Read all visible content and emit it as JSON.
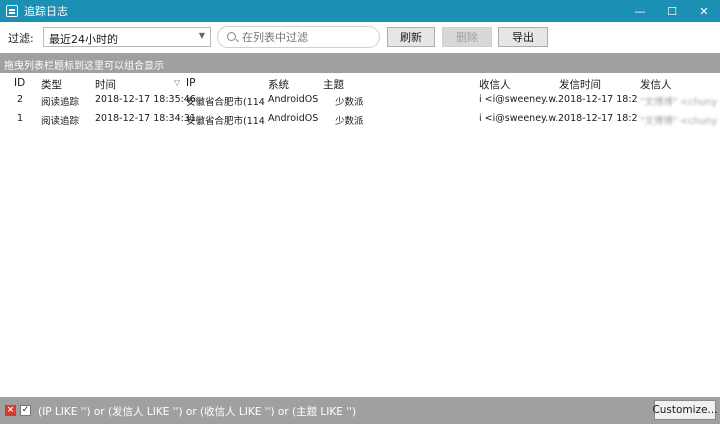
{
  "window": {
    "title": "追踪日志",
    "minimize": "—",
    "maximize": "☐",
    "close": "✕"
  },
  "toolbar": {
    "filter_label": "过滤:",
    "filter_value": "最近24小时的",
    "search_placeholder": "在列表中过滤",
    "refresh_label": "刷新",
    "delete_label": "删除",
    "export_label": "导出"
  },
  "group_panel": {
    "hint": "拖曳列表栏题标到这里可以组合显示"
  },
  "columns": {
    "id": "ID",
    "type": "类型",
    "time": "时间",
    "ip": "IP",
    "system": "系统",
    "subject": "主题",
    "recipient": "收信人",
    "sent_time": "发信时间",
    "sender": "发信人"
  },
  "rows": [
    {
      "id": "2",
      "type": "阅读追踪",
      "time": "2018-12-17 18:35:46",
      "ip": "安徽省合肥市(114....",
      "system": "AndroidOS",
      "subject": "少数派",
      "recipient": "i <i@sweeney.w...",
      "sent_time": "2018-12-17 18:27...",
      "sender": "\"文博博\" <chunyu..."
    },
    {
      "id": "1",
      "type": "阅读追踪",
      "time": "2018-12-17 18:34:31",
      "ip": "安徽省合肥市(114....",
      "system": "AndroidOS",
      "subject": "少数派",
      "recipient": "i <i@sweeney.w...",
      "sent_time": "2018-12-17 18:27...",
      "sender": "\"文博博\" <chunyu..."
    }
  ],
  "statusbar": {
    "filter_expression": "(IP LIKE '') or (发信人 LIKE '') or (收信人 LIKE '') or (主题 LIKE '')",
    "customize_label": "Customize..."
  }
}
